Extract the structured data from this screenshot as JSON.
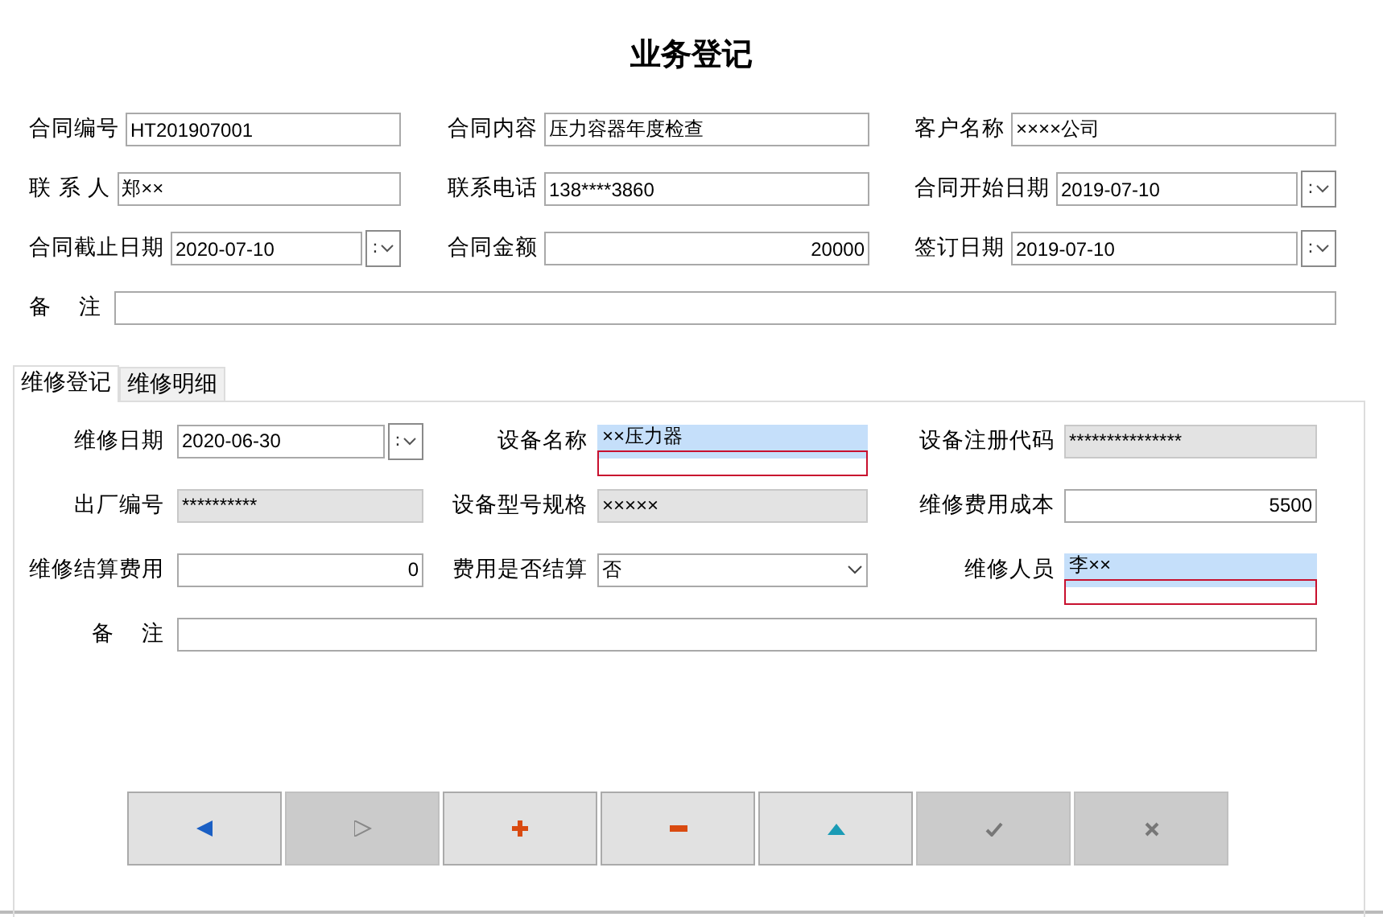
{
  "title": "业务登记",
  "contract_rows": [
    [
      {
        "label": "合同编号",
        "kind": "text",
        "value": "HT201907001"
      },
      {
        "label": "合同内容",
        "kind": "text",
        "value": "压力容器年度检查"
      },
      {
        "label": "客户名称",
        "kind": "text",
        "value": "××××公司"
      }
    ],
    [
      {
        "label": "联 系 人",
        "kind": "text",
        "value": "郑××"
      },
      {
        "label": "联系电话",
        "kind": "text",
        "value": "138****3860"
      },
      {
        "label": "合同开始日期",
        "kind": "date",
        "value": "2019-07-10",
        "picker": ":"
      }
    ],
    [
      {
        "label": "合同截止日期",
        "kind": "date",
        "value": "2020-07-10",
        "picker": ":"
      },
      {
        "label": "合同金额",
        "kind": "number",
        "value": "20000"
      },
      {
        "label": "签订日期",
        "kind": "date",
        "value": "2019-07-10",
        "picker": ":"
      }
    ]
  ],
  "contract_remark": {
    "label": "备    注"
  },
  "tabs": [
    {
      "label": "维修登记",
      "selected": true
    },
    {
      "label": "维修明细",
      "selected": false
    }
  ],
  "repair_rows": [
    [
      {
        "label": "维修日期",
        "kind": "date",
        "value": "2020-06-30",
        "picker": ":"
      },
      {
        "label": "设备名称",
        "kind": "text",
        "value": "××压力器",
        "flagged": true
      },
      {
        "label": "设备注册代码",
        "kind": "text",
        "value": "***************",
        "disabled": true
      }
    ],
    [
      {
        "label": "出厂编号",
        "kind": "text",
        "value": "**********",
        "disabled": true
      },
      {
        "label": "设备型号规格",
        "kind": "text",
        "value": "×××××",
        "disabled": true
      },
      {
        "label": "维修费用成本",
        "kind": "number",
        "value": "5500"
      }
    ],
    [
      {
        "label": "维修结算费用",
        "kind": "number",
        "value": "0"
      },
      {
        "label": "费用是否结算",
        "kind": "select",
        "value": "否"
      },
      {
        "label": "维修人员",
        "kind": "text",
        "value": "李××",
        "flagged": true
      }
    ]
  ],
  "repair_remark": {
    "label": "备    注"
  },
  "toolbar": [
    {
      "kind": "prev",
      "disabled": false
    },
    {
      "kind": "next",
      "disabled": true
    },
    {
      "kind": "add",
      "disabled": false
    },
    {
      "kind": "remove",
      "disabled": false
    },
    {
      "kind": "up",
      "disabled": false
    },
    {
      "kind": "confirm",
      "disabled": true
    },
    {
      "kind": "cancel",
      "disabled": true
    }
  ]
}
